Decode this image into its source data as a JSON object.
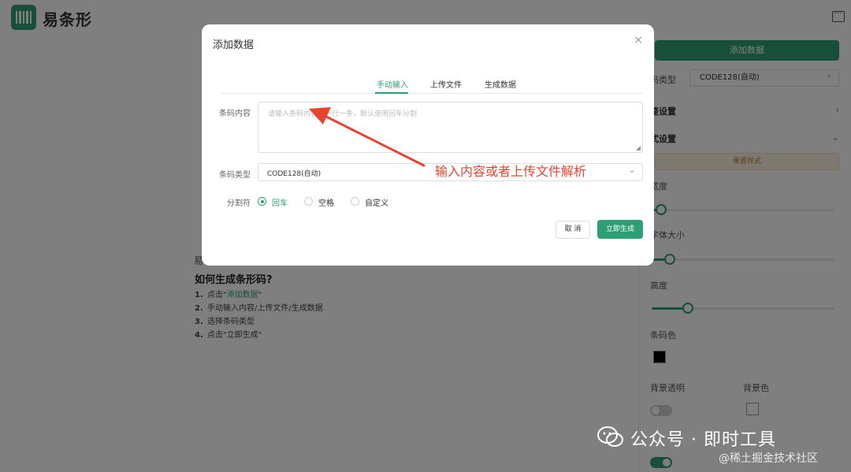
{
  "app": {
    "brand": "易条形"
  },
  "help": {
    "dim_label": "易",
    "heading": "如何生成条形码?",
    "steps": [
      {
        "num": "1.",
        "pre": "点击\"",
        "link": "添加数据",
        "post": "\""
      },
      {
        "num": "2.",
        "text": "手动输入内容/上传文件/生成数据"
      },
      {
        "num": "3.",
        "text": "选择条码类型"
      },
      {
        "num": "4.",
        "text": "点击\"立即生成\""
      }
    ]
  },
  "right_panel": {
    "add_button": "添加数据",
    "type_label": "码类型",
    "type_value": "CODE128(自动)",
    "section1": "整设置",
    "section2": "式设置",
    "reset_button": "重置样式",
    "width_label": "宽度",
    "font_size_label": "字体大小",
    "height_label": "高度",
    "bar_color_label": "条码色",
    "bg_transparent_label": "背景透明",
    "bg_color_label": "背景色",
    "sliders": {
      "width": 0.05,
      "font_size": 0.1,
      "height": 0.2
    },
    "toggles": {
      "bg_transparent": false,
      "bottom": true
    }
  },
  "modal": {
    "title": "添加数据",
    "close": "×",
    "tabs": [
      "手动输入",
      "上传文件",
      "生成数据"
    ],
    "active_tab": 0,
    "content_label": "条码内容",
    "content_placeholder": "请输入条码内容，一行一条，默认使用回车分割",
    "type_label": "条码类型",
    "type_value": "CODE128(自动)",
    "separator_label": "分割符",
    "separators": [
      "回车",
      "空格",
      "自定义"
    ],
    "selected_separator": 0,
    "cancel": "取 消",
    "submit": "立即生成"
  },
  "annotation": {
    "text": "输入内容或者上传文件解析"
  },
  "watermark": {
    "line1": "公众号 · 即时工具",
    "line2": "@稀土掘金技术社区"
  },
  "colors": {
    "accent": "#2e9e74",
    "annotation": "#e5452e"
  }
}
